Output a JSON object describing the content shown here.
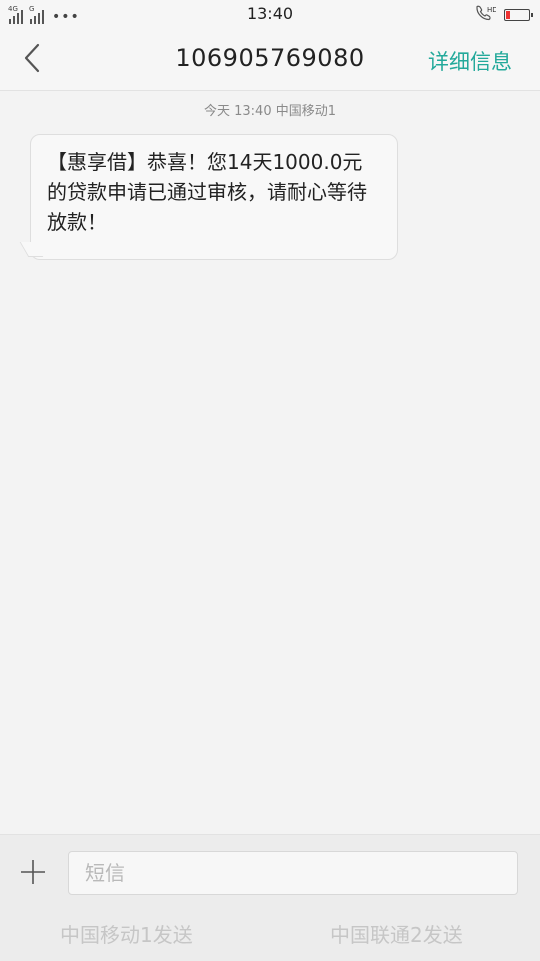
{
  "status_bar": {
    "signal_1_tag": "4G",
    "signal_2_tag": "G",
    "time": "13:40",
    "hd_label": "HD",
    "battery_color": "#e33"
  },
  "header": {
    "title": "106905769080",
    "details_label": "详细信息",
    "accent_color": "#23a99b"
  },
  "conversation": {
    "meta": "今天  13:40  中国移动1",
    "messages": [
      {
        "text": "【惠享借】恭喜！您14天1000.0元的贷款申请已通过审核，请耐心等待放款！"
      }
    ]
  },
  "composer": {
    "placeholder": "短信",
    "send_sim1_label": "中国移动1发送",
    "send_sim2_label": "中国联通2发送"
  },
  "icons": {
    "back": "chevron-left-icon",
    "add": "plus-icon",
    "call_hd": "phone-hd-icon",
    "battery": "battery-icon",
    "signal": "signal-icon"
  }
}
